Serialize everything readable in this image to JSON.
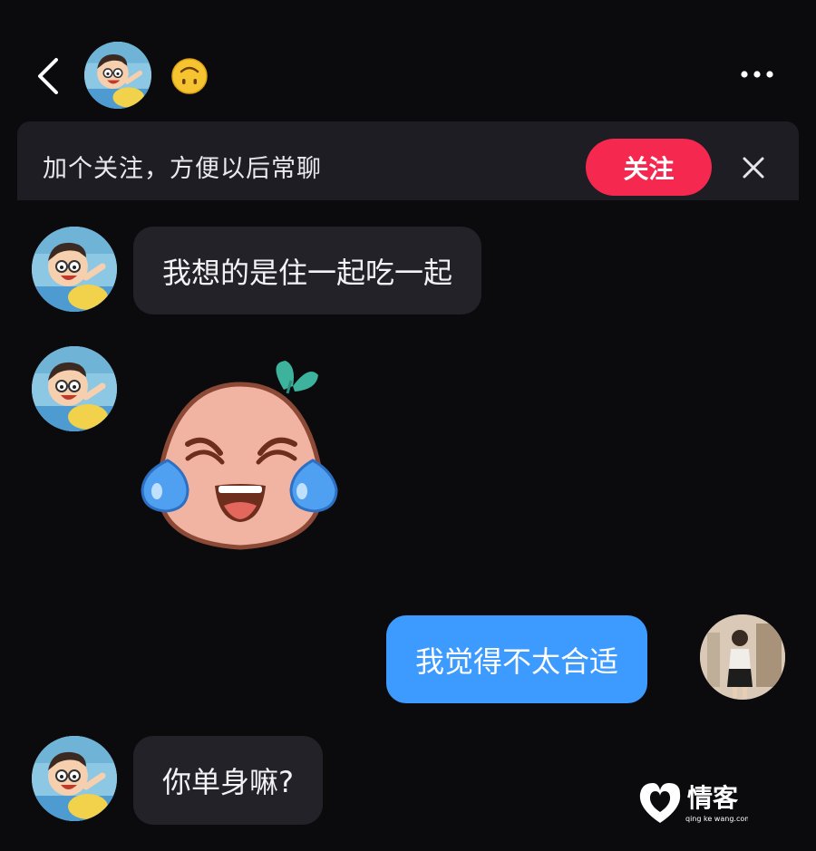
{
  "header": {
    "back_icon": "chevron-left-icon",
    "contact_avatar": "cartoon-boy-avatar",
    "status_emoji": "upside-down-face-emoji",
    "more_icon": "more-horizontal-icon"
  },
  "banner": {
    "text": "加个关注，方便以后常聊",
    "follow_label": "关注",
    "close_icon": "close-icon",
    "accent_color": "#f5294f"
  },
  "messages": [
    {
      "sender": "contact",
      "type": "text",
      "text": "我想的是住一起吃一起"
    },
    {
      "sender": "contact",
      "type": "sticker",
      "sticker": "crying-laughing-sticker"
    },
    {
      "sender": "me",
      "type": "text",
      "text": "我觉得不太合适"
    },
    {
      "sender": "contact",
      "type": "text",
      "text": "你单身嘛?"
    }
  ],
  "watermark": {
    "brand": "情客",
    "url": "qing ke wang.com"
  },
  "colors": {
    "background": "#0b0b0e",
    "incoming_bubble": "#222228",
    "outgoing_bubble": "#3d9bff"
  }
}
